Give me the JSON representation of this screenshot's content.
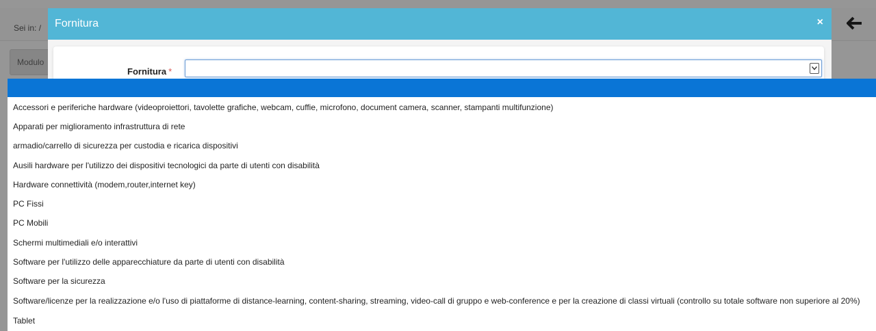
{
  "background": {
    "breadcrumb_label": "Sei in:",
    "breadcrumb_sep": "/",
    "tab_label": "Modulo",
    "back_icon": "arrow-left-icon"
  },
  "modal": {
    "title": "Fornitura",
    "close_symbol": "×",
    "field_label": "Fornitura",
    "required_mark": "*",
    "select_value": ""
  },
  "dropdown": {
    "options": [
      "",
      "Accessori e periferiche hardware (videoproiettori, tavolette grafiche, webcam, cuffie, microfono, document camera, scanner, stampanti multifunzione)",
      "Apparati per miglioramento infrastruttura di rete",
      "armadio/carrello di sicurezza per custodia e ricarica dispositivi",
      "Ausili hardware per l'utilizzo dei dispositivi tecnologici da parte di utenti con disabilità",
      "Hardware connettività (modem,router,internet key)",
      "PC Fissi",
      "PC Mobili",
      "Schermi multimediali e/o interattivi",
      "Software per l'utilizzo delle apparecchiature da parte di utenti con disabilità",
      "Software per la sicurezza",
      "Software/licenze per la realizzazione e/o l'uso di piattaforme di distance-learning, content-sharing, streaming, video-call di gruppo e web-conference e per la creazione di classi virtuali (controllo su totale software non superiore al 20%)",
      "Tablet"
    ],
    "selected_index": 0
  },
  "colors": {
    "header": "#52b6d6",
    "selected_option": "#0a75d6",
    "required": "#d9534f"
  }
}
